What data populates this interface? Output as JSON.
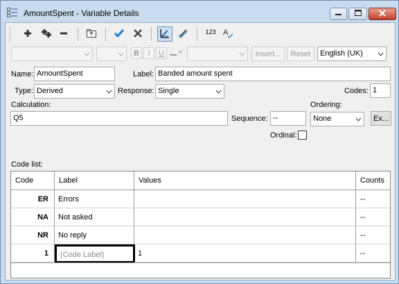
{
  "window": {
    "title": "AmountSpent - Variable Details",
    "icon": "variable-grid-icon",
    "controls": [
      "minimize-icon",
      "maximize-icon",
      "close-icon"
    ]
  },
  "toolbar": {
    "buttons": [
      {
        "icon": "add-icon"
      },
      {
        "icon": "add-multiple-icon"
      },
      {
        "icon": "remove-icon"
      },
      {
        "icon": "move-up-level-icon"
      },
      {
        "icon": "check-icon"
      },
      {
        "icon": "cancel-icon"
      },
      {
        "icon": "ruler-icon",
        "pressed": true
      },
      {
        "icon": "pen-check-icon"
      },
      {
        "icon": "numbering-icon",
        "text": "123"
      },
      {
        "icon": "spell-check-icon",
        "text": "A"
      }
    ]
  },
  "format": {
    "bold": "B",
    "italic": "I",
    "underline": "U",
    "insert_label": "Insert...",
    "reset_label": "Reset",
    "language": "English (UK)"
  },
  "form": {
    "name_label": "Name:",
    "name_value": "AmountSpent",
    "label_label": "Label:",
    "label_value": "Banded amount spent",
    "type_label": "Type:",
    "type_value": "Derived",
    "response_label": "Response:",
    "response_value": "Single",
    "codes_label": "Codes:",
    "codes_value": "1",
    "calculation_label": "Calculation:",
    "calculation_value": "Q5",
    "sequence_label": "Sequence:",
    "sequence_value": "--",
    "ordering_label": "Ordering:",
    "ordering_value": "None",
    "ex_button": "Ex...",
    "ordinal_label": "Ordinal:",
    "ordinal_checked": false
  },
  "codelist": {
    "title": "Code list:",
    "columns": [
      "Code",
      "Label",
      "Values",
      "Counts"
    ],
    "rows": [
      {
        "code": "ER",
        "label": "Errors",
        "values": "",
        "counts": "--"
      },
      {
        "code": "NA",
        "label": "Not asked",
        "values": "",
        "counts": "--"
      },
      {
        "code": "NR",
        "label": "No reply",
        "values": "",
        "counts": "--"
      },
      {
        "code": "1",
        "label": "(Code Label)",
        "values": "1",
        "counts": "--"
      }
    ]
  }
}
